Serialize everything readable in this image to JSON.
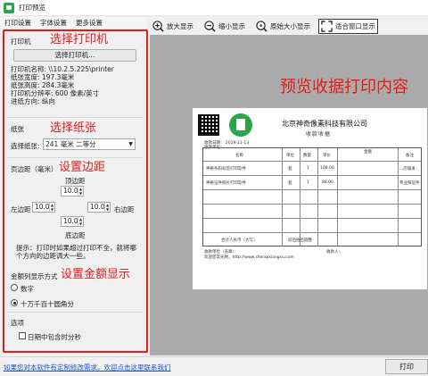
{
  "window": {
    "title": "打印预览"
  },
  "menu": [
    "打印设置",
    "字体设置",
    "更多设置"
  ],
  "toolbar": {
    "zoom_in": "放大显示",
    "zoom_out": "缩小显示",
    "original_size": "原始大小显示",
    "fit_window": "适合窗口显示"
  },
  "printer": {
    "section_title": "打印机",
    "annotation": "选择打印机",
    "select_button": "选择打印机...",
    "name": "打印机名称: \\\\10.2.5.225\\printer",
    "paper_width": "纸张宽度: 197.3毫米",
    "paper_height": "纸张高度: 284.3毫米",
    "resolution": "打印机分辨率: 600 像素/英寸",
    "orientation": "进纸方向: 纵向"
  },
  "paper": {
    "section_title": "纸张",
    "annotation": "选择纸张",
    "select_label": "选择纸张:",
    "selected": "241 毫米 二等分"
  },
  "margins": {
    "section_title": "页边距（毫米）",
    "annotation": "设置边距",
    "top_label": "顶边距",
    "top_value": "10.0",
    "left_label": "左边距",
    "left_value": "10.0",
    "right_label": "右边距",
    "right_value": "10.0",
    "bottom_label": "底边距",
    "bottom_value": "10.0",
    "hint": "提示：打印时如果超过打印不全，就将哪个方向的边距调大一些。"
  },
  "amount": {
    "section_title": "金额列显示方式",
    "annotation": "设置金额显示",
    "option_number": "数字",
    "option_digits": "十万千百十圆角分"
  },
  "options": {
    "section_title": "选项",
    "date_time": "日期中包含时分秒"
  },
  "preview": {
    "annotation": "预览收据打印内容",
    "company": "北京神奇像素科技有限公司",
    "doc_title": "收款收据",
    "receipt_date": "收款日期：  2019-11-13",
    "receipt_no": "收款单位：",
    "col_name": "名称",
    "col_unit": "单位",
    "col_qty": "数量",
    "col_price": "单价",
    "col_amount": "金额",
    "col_note": "备注",
    "row1_name": "神奇条码标签打印软件",
    "row1_unit": "套",
    "row1_qty": "1",
    "row1_price": "108.00",
    "row1_note": "...店铺发...",
    "row2_name": "神奇证件照片打印软件",
    "row2_unit": "套",
    "row2_qty": "1",
    "row2_price": "88.00",
    "row2_note": "专业照证件",
    "total_label": "合计人民币（大写）",
    "total_value": "贰佰拾佰圆整",
    "payer": "收款单位（盖章）：",
    "handler": "收款人：",
    "welcome": "欢迎您常光顾，http://www.shenqixiangsu.com"
  },
  "bottom": {
    "link": "如果您对本软件有定制修改需求，欢迎点击这里联系我们",
    "print_button": "打印"
  },
  "colors": {
    "accent_red": "#e21b1b",
    "app_green": "#2aa64a",
    "link_blue": "#1a56c9"
  }
}
